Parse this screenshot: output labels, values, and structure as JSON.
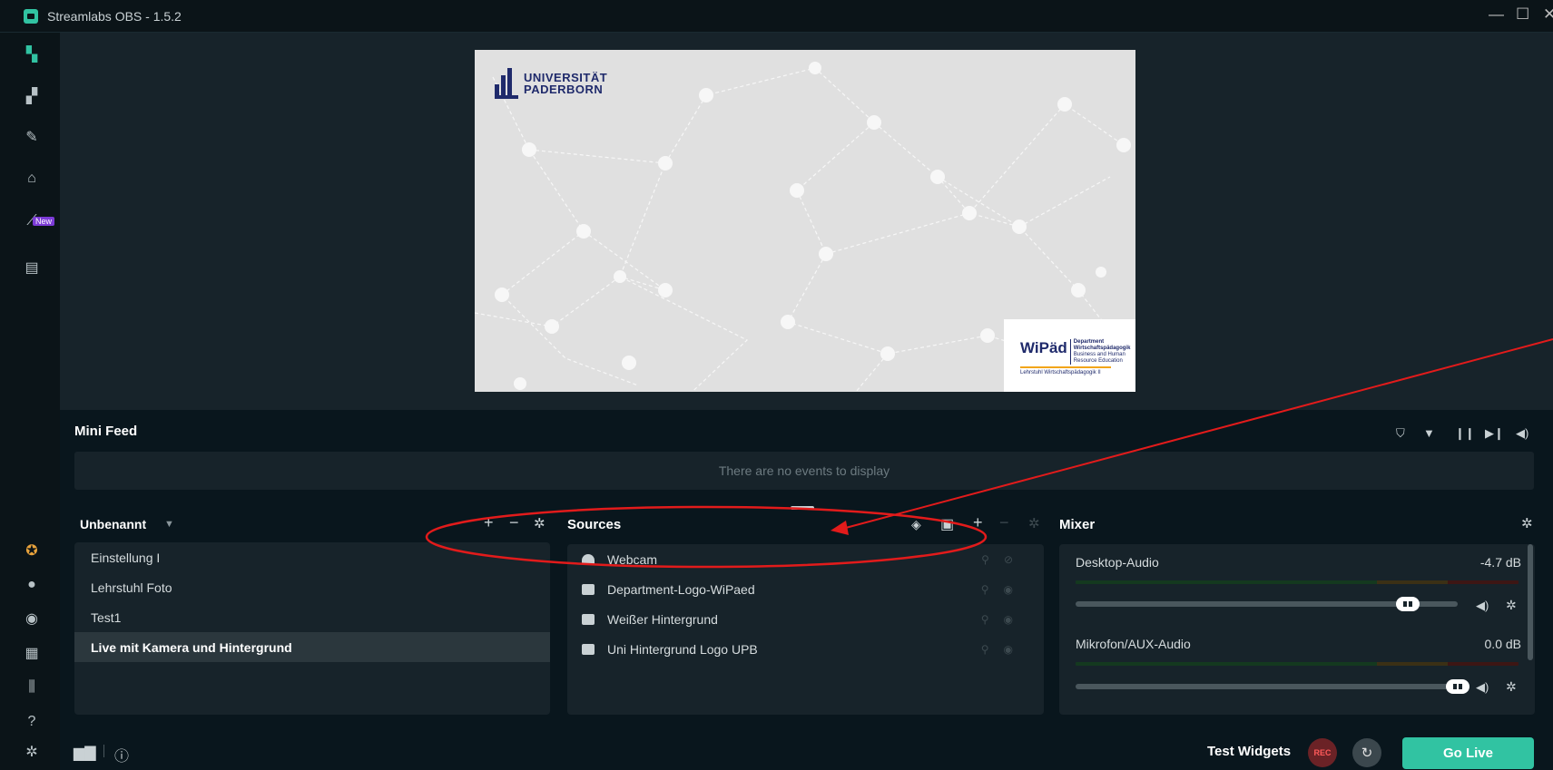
{
  "window": {
    "title": "Streamlabs OBS - 1.5.2",
    "minimize_glyph": "—",
    "maximize_glyph": "☐",
    "close_glyph": "✕"
  },
  "leftbar": {
    "icons": [
      "editor-icon",
      "layout-icon",
      "themes-icon",
      "store-icon",
      "dashboard-icon",
      "highlighter-icon"
    ],
    "new_badge": "New",
    "bottom_icons": [
      "prime-icon",
      "alert-box-icon",
      "chat-icon",
      "apps-icon",
      "studio-mode-icon",
      "help-icon",
      "settings-icon"
    ]
  },
  "preview": {
    "upb_logo_line1": "UNIVERSITÄT",
    "upb_logo_line2": "PADERBORN",
    "wipaed_word": "WiPäd",
    "wipaed_dept_line1": "Department",
    "wipaed_dept_line2": "Wirtschaftspädagogik",
    "wipaed_sub_line1": "Business and Human",
    "wipaed_sub_line2": "Resource Education",
    "wipaed_footer": "Lehrstuhl Wirtschaftspädagogik II"
  },
  "minifeed": {
    "title": "Mini Feed",
    "empty_text": "There are no events to display"
  },
  "scenes": {
    "collection_name": "Unbenannt",
    "items": [
      {
        "label": "Einstellung I",
        "selected": false
      },
      {
        "label": "Lehrstuhl Foto",
        "selected": false
      },
      {
        "label": "Test1",
        "selected": false
      },
      {
        "label": "Live mit Kamera und Hintergrund",
        "selected": true
      }
    ]
  },
  "sources": {
    "title": "Sources",
    "items": [
      {
        "label": "Webcam",
        "icon": "webcam-icon"
      },
      {
        "label": "Department-Logo-WiPaed",
        "icon": "image-icon"
      },
      {
        "label": "Weißer Hintergrund",
        "icon": "image-icon"
      },
      {
        "label": "Uni Hintergrund Logo UPB",
        "icon": "image-icon"
      }
    ]
  },
  "mixer": {
    "title": "Mixer",
    "channels": [
      {
        "label": "Desktop-Audio",
        "db": "-4.7 dB",
        "volume": 0.87
      },
      {
        "label": "Mikrofon/AUX-Audio",
        "db": "0.0 dB",
        "volume": 1.0
      }
    ]
  },
  "footer": {
    "test_widgets": "Test Widgets",
    "rec": "REC",
    "go_live": "Go Live"
  },
  "annotation": {
    "color": "#e21b1b"
  }
}
